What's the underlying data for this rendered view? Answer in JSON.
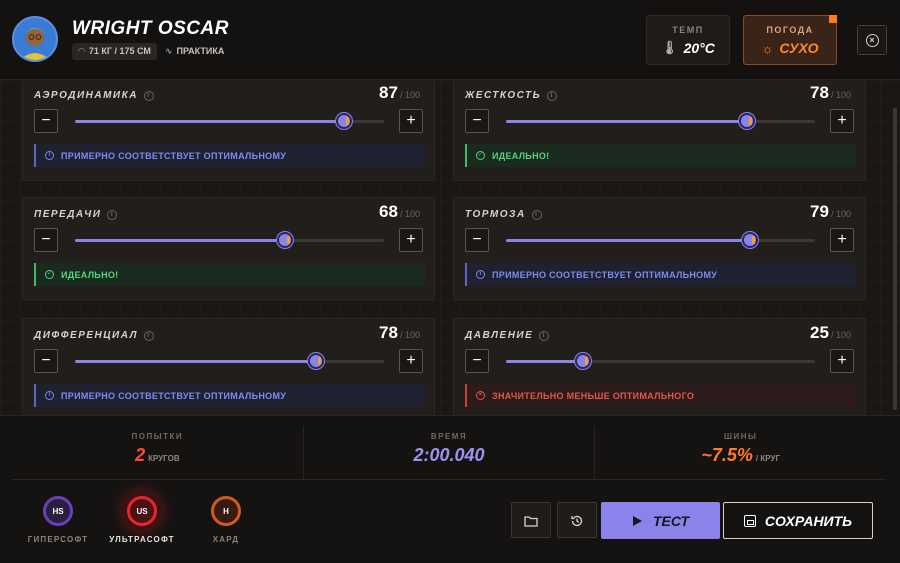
{
  "driver": {
    "name": "WRIGHT OSCAR",
    "weight_height": "71 КГ / 175 СМ",
    "mode": "ПРАКТИКА"
  },
  "weather": {
    "temp_label": "ТЕМП",
    "temp_value": "20°C",
    "condition_label": "ПОГОДА",
    "condition_value": "СУХО"
  },
  "setup": {
    "max_label": "/ 100",
    "items": [
      {
        "label": "АЭРОДИНАМИКА",
        "value": 87,
        "status": "ПРИМЕРНО СООТВЕТСТВУЕТ ОПТИМАЛЬНОМУ",
        "status_type": "approx"
      },
      {
        "label": "ЖЕСТКОСТЬ",
        "value": 78,
        "status": "ИДЕАЛЬНО!",
        "status_type": "ideal"
      },
      {
        "label": "ПЕРЕДАЧИ",
        "value": 68,
        "status": "ИДЕАЛЬНО!",
        "status_type": "ideal"
      },
      {
        "label": "ТОРМОЗА",
        "value": 79,
        "status": "ПРИМЕРНО СООТВЕТСТВУЕТ ОПТИМАЛЬНОМУ",
        "status_type": "approx"
      },
      {
        "label": "ДИФФЕРЕНЦИАЛ",
        "value": 78,
        "status": "ПРИМЕРНО СООТВЕТСТВУЕТ ОПТИМАЛЬНОМУ",
        "status_type": "approx"
      },
      {
        "label": "ДАВЛЕНИЕ",
        "value": 25,
        "status": "ЗНАЧИТЕЛЬНО МЕНЬШЕ ОПТИМАЛЬНОГО",
        "status_type": "low"
      }
    ]
  },
  "summary": {
    "attempts_label": "ПОПЫТКИ",
    "attempts_value": "2",
    "attempts_unit": "КРУГОВ",
    "time_label": "ВРЕМЯ",
    "time_value": "2:00.040",
    "tyres_label": "ШИНЫ",
    "tyres_value": "~7.5%",
    "tyres_unit": "/ КРУГ"
  },
  "tyres": {
    "selected": "УЛЬТРАСОФТ",
    "items": [
      {
        "code": "HS",
        "label": "ГИПЕРСОФТ"
      },
      {
        "code": "US",
        "label": "УЛЬТРАСОФТ"
      },
      {
        "code": "H",
        "label": "ХАРД"
      }
    ]
  },
  "actions": {
    "test_label": "ТЕСТ",
    "save_label": "СОХРАНИТЬ"
  },
  "colors": {
    "accent": "#8a84ea",
    "approx": "#7d8cf0",
    "ideal": "#52d57c",
    "low": "#e2574a",
    "weather_accent": "#ff7a1a"
  },
  "icons": {
    "close": "close-icon",
    "folder": "folder-icon",
    "history": "history-icon",
    "play": "play-icon",
    "save": "save-icon"
  }
}
